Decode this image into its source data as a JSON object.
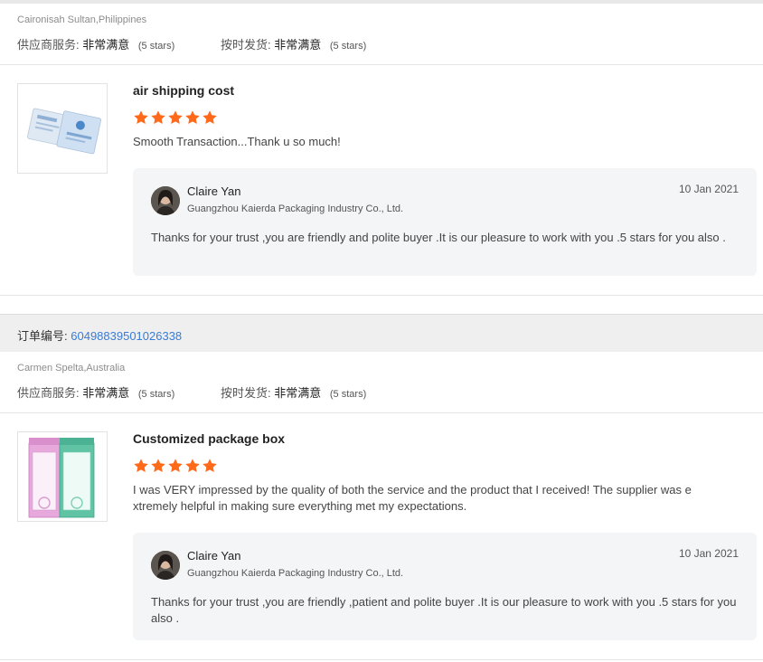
{
  "reviews": [
    {
      "buyer_location": "Caironisah Sultan,Philippines",
      "supplier_service_label": "供应商服务:",
      "supplier_service_value": "非常满意",
      "supplier_service_stars": "(5 stars)",
      "shipping_label": "按时发货:",
      "shipping_value": "非常满意",
      "shipping_stars": "(5 stars)",
      "product_title": "air shipping cost",
      "rating": 5,
      "comment": "Smooth Transaction...Thank u so much!",
      "reply": {
        "seller_name": "Claire Yan",
        "company": "Guangzhou Kaierda Packaging Industry Co., Ltd.",
        "date": "10 Jan 2021",
        "text": "Thanks for your trust ,you are friendly and polite buyer .It is our pleasure to work with you .5 stars for you also ."
      }
    },
    {
      "order_label": "订单编号:",
      "order_number": "60498839501026338",
      "buyer_location": "Carmen Spelta,Australia",
      "supplier_service_label": "供应商服务:",
      "supplier_service_value": "非常满意",
      "supplier_service_stars": "(5 stars)",
      "shipping_label": "按时发货:",
      "shipping_value": "非常满意",
      "shipping_stars": "(5 stars)",
      "product_title": "Customized package box",
      "rating": 5,
      "comment": "I was VERY impressed by the quality of both the service and the product that I received! The supplier was e xtremely helpful in making sure everything met my expectations.",
      "reply": {
        "seller_name": "Claire Yan",
        "company": "Guangzhou Kaierda Packaging Industry Co., Ltd.",
        "date": "10 Jan 2021",
        "text": "Thanks for your trust ,you are friendly ,patient and polite buyer .It is our pleasure to work with you .5 stars for you also ."
      }
    }
  ],
  "colors": {
    "star": "#ff6a1a",
    "link": "#3a7bd5",
    "reply_bg": "#f4f5f7"
  }
}
